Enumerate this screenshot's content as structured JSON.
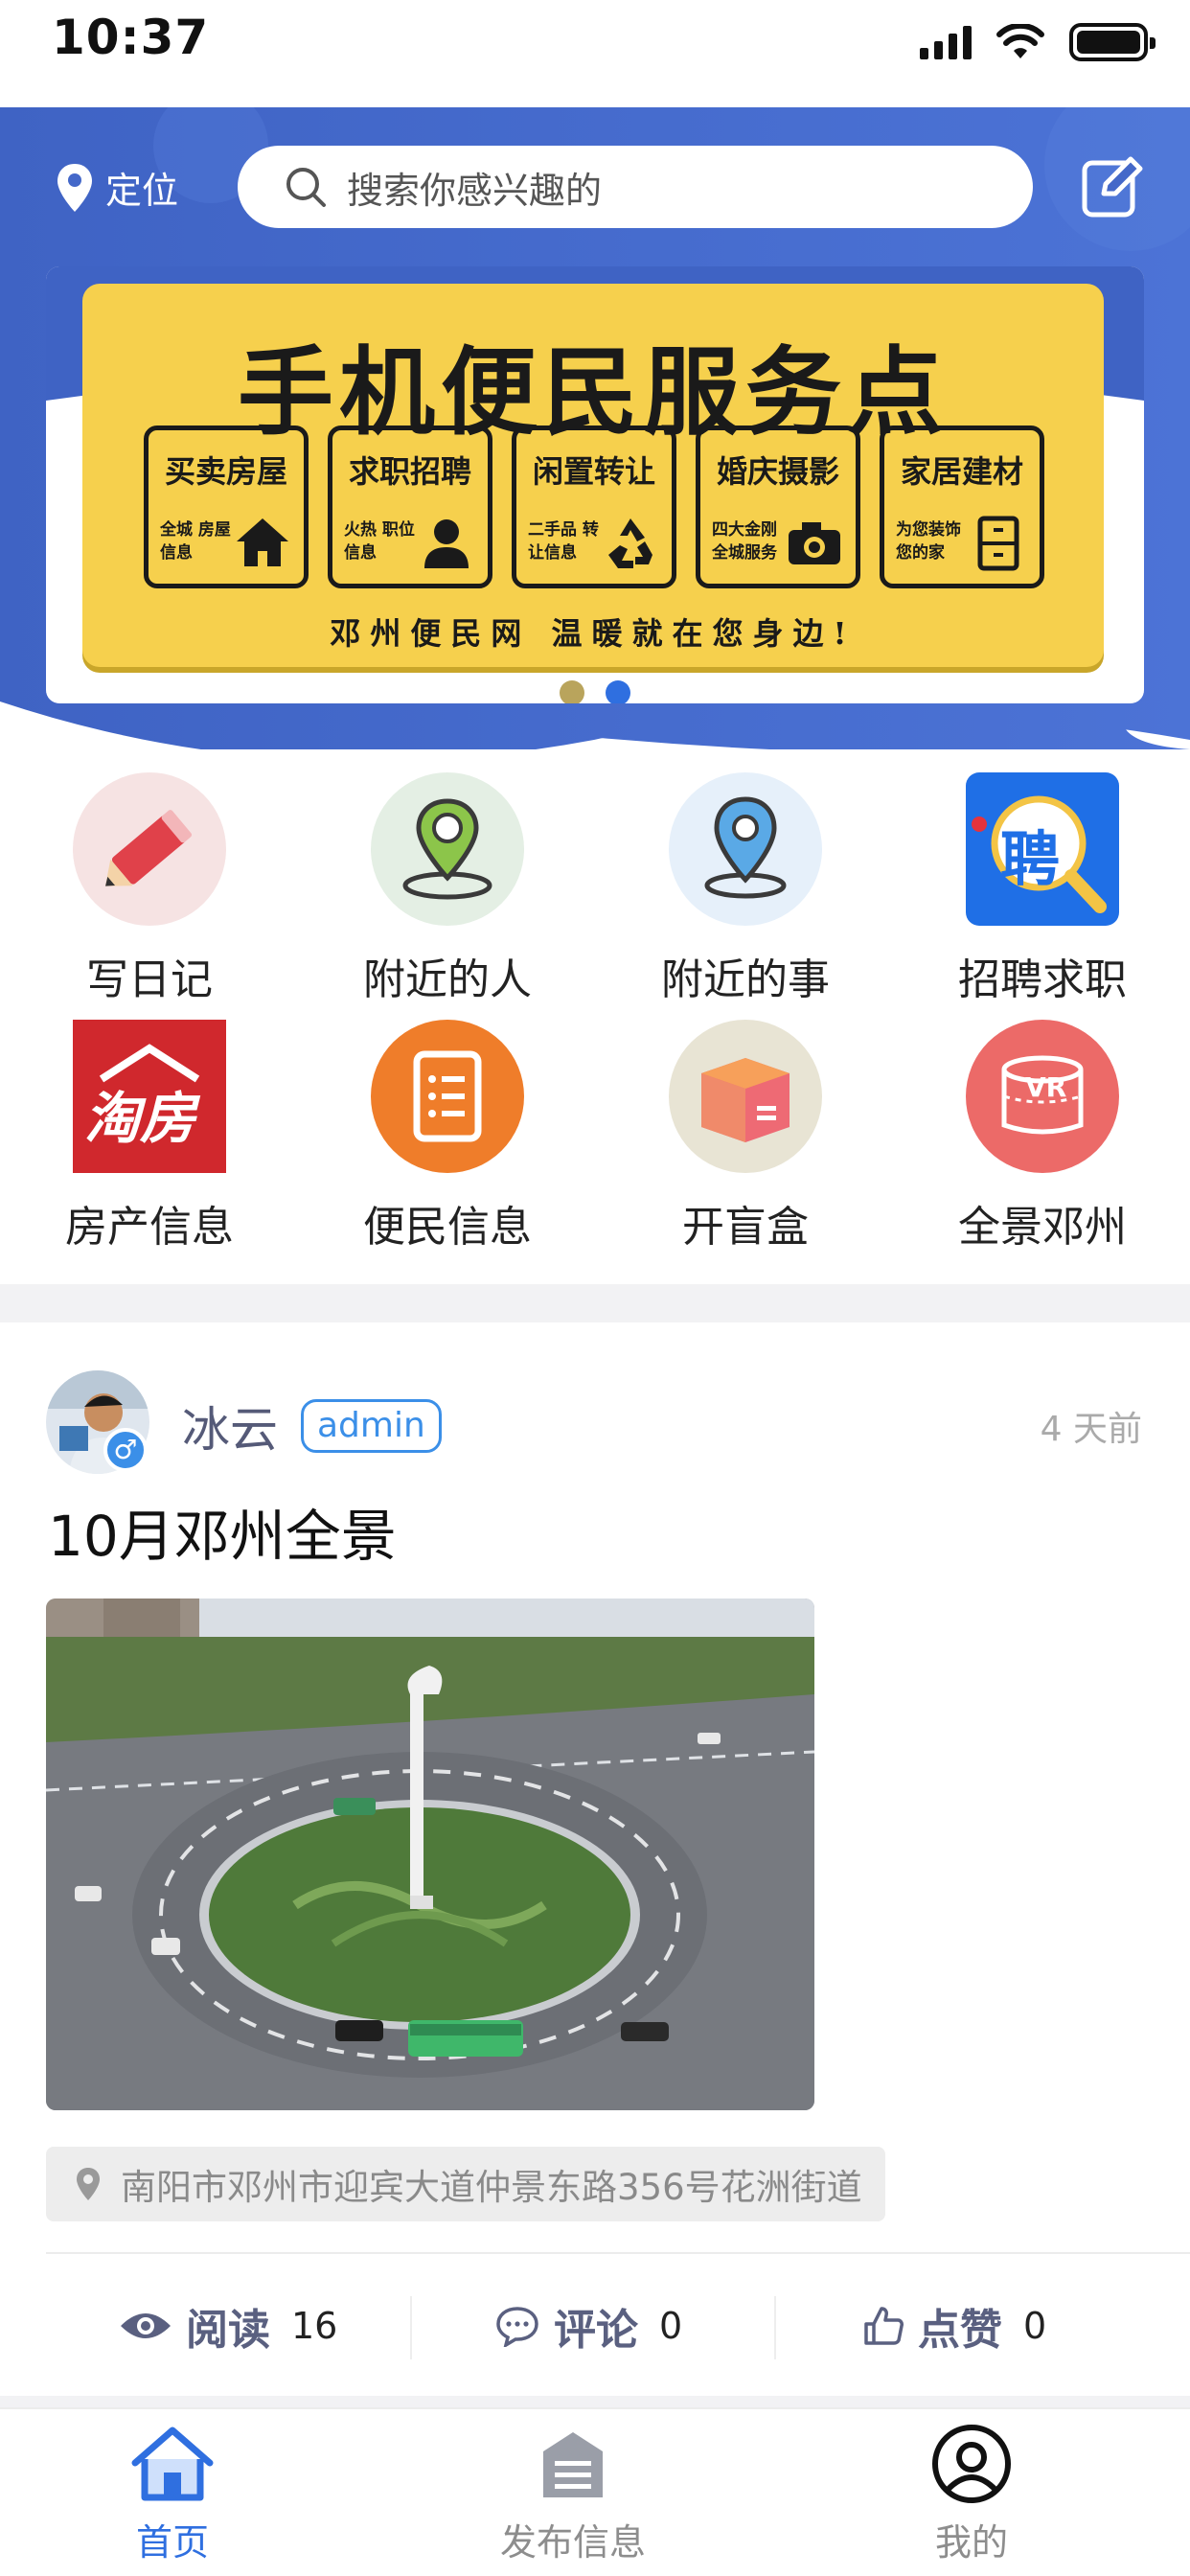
{
  "status_bar": {
    "time": "10:37"
  },
  "header": {
    "location_label": "定位",
    "search_placeholder": "搜索你感兴趣的"
  },
  "banner": {
    "title": "手机便民服务点",
    "tiles": [
      {
        "title": "买卖房屋",
        "sub": "全城 房屋信息",
        "icon": "house-icon"
      },
      {
        "title": "求职招聘",
        "sub": "火热 职位信息",
        "icon": "person-icon"
      },
      {
        "title": "闲置转让",
        "sub": "二手品 转让信息",
        "icon": "recycle-icon"
      },
      {
        "title": "婚庆摄影",
        "sub": "四大金刚 全城服务",
        "icon": "camera-icon"
      },
      {
        "title": "家居建材",
        "sub": "为您装饰 您的家",
        "icon": "cabinet-icon"
      }
    ],
    "slogan": "邓州便民网 温暖就在您身边!",
    "slide_count": 2,
    "active_slide": 2
  },
  "quick_menu": [
    {
      "label": "写日记",
      "icon": "pencil-icon"
    },
    {
      "label": "附近的人",
      "icon": "nearby-people-icon"
    },
    {
      "label": "附近的事",
      "icon": "nearby-pin-icon"
    },
    {
      "label": "招聘求职",
      "icon": "recruit-icon",
      "icon_text": "聘"
    },
    {
      "label": "房产信息",
      "icon": "real-estate-icon",
      "icon_text": "淘房"
    },
    {
      "label": "便民信息",
      "icon": "list-icon"
    },
    {
      "label": "开盲盒",
      "icon": "blind-box-icon"
    },
    {
      "label": "全景邓州",
      "icon": "vr-icon",
      "icon_text": "VR"
    }
  ],
  "post": {
    "author": "冰云",
    "role": "admin",
    "gender_symbol": "♂",
    "time": "4 天前",
    "title": "10月邓州全景",
    "address": "南阳市邓州市迎宾大道仲景东路356号花洲街道",
    "stats": {
      "read_label": "阅读",
      "read_count": "16",
      "comment_label": "评论",
      "comment_count": "0",
      "like_label": "点赞",
      "like_count": "0"
    }
  },
  "tabbar": {
    "items": [
      {
        "label": "首页",
        "active": true
      },
      {
        "label": "发布信息",
        "active": false
      },
      {
        "label": "我的",
        "active": false
      }
    ]
  },
  "colors": {
    "primary": "#2f6fe0",
    "hero_blue": "#4468c9",
    "banner_yellow": "#f6d04d"
  }
}
